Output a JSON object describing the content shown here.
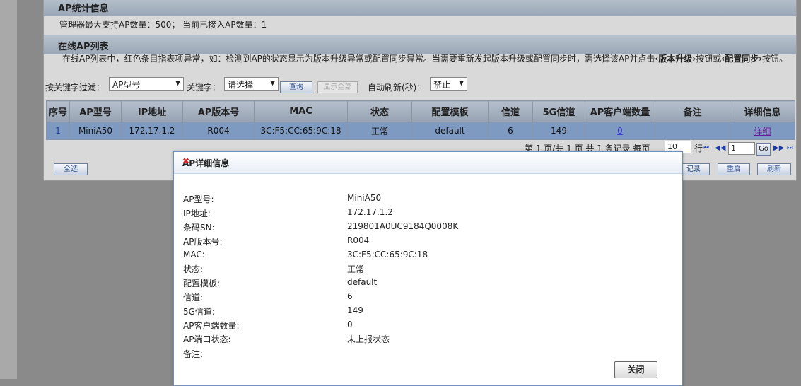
{
  "section1": {
    "title": "AP统计信息"
  },
  "stats": {
    "text": "管理器最大支持AP数量：500；  当前已接入AP数量：1"
  },
  "section2": {
    "title": "在线AP列表"
  },
  "description": {
    "part1": "在线AP列表中，红色条目指表项异常，如：检测到AP的状态显示为版本升级异常或配置同步异常。当需要重新发起版本升级或配置同步时，需选择该AP并点击",
    "btn1": "‹版本升级›",
    "mid": "按钮或",
    "btn2": "‹配置同步›",
    "part2": "按钮。"
  },
  "filter": {
    "label": "按关键字过滤：",
    "field_value": "AP型号",
    "keyword_label": "关键字：",
    "keyword_value": "请选择",
    "query_button": "查询",
    "show_all_button": "显示全部",
    "refresh_label": "自动刷新(秒)：",
    "refresh_value": "禁止"
  },
  "table": {
    "headers": [
      "序号",
      "AP型号",
      "IP地址",
      "AP版本号",
      "MAC",
      "状态",
      "配置模板",
      "信道",
      "5G信道",
      "AP客户端数量",
      "备注",
      "详细信息"
    ],
    "row": {
      "index": "1",
      "model": "MiniA50",
      "ip": "172.17.1.2",
      "version": "R004",
      "mac": "3C:F5:CC:65:9C:18",
      "status": "正常",
      "template": "default",
      "channel": "6",
      "channel5g": "149",
      "clients": "0",
      "note": "",
      "detail": "详细"
    }
  },
  "pager": {
    "summary": "第 1 页/共 1 页 共 1 条记录 每页",
    "per_page": "10",
    "rows_label": "行",
    "page_input": "1",
    "go": "Go"
  },
  "bottom_buttons": {
    "select_all": "全选",
    "record": "记录",
    "restart": "重启",
    "refresh": "刷新"
  },
  "modal": {
    "title": "AP详细信息",
    "fields": [
      {
        "label": "AP型号:",
        "value": "MiniA50"
      },
      {
        "label": "IP地址:",
        "value": "172.17.1.2"
      },
      {
        "label": "条码SN:",
        "value": "219801A0UC9184Q0008K"
      },
      {
        "label": "AP版本号:",
        "value": "R004"
      },
      {
        "label": "MAC:",
        "value": "3C:F5:CC:65:9C:18"
      },
      {
        "label": "状态:",
        "value": "正常"
      },
      {
        "label": "配置模板:",
        "value": "default"
      },
      {
        "label": "信道:",
        "value": "6"
      },
      {
        "label": "5G信道:",
        "value": "149"
      },
      {
        "label": "AP客户端数量:",
        "value": "0"
      },
      {
        "label": "AP端口状态:",
        "value": "未上报状态"
      },
      {
        "label": "备注:",
        "value": ""
      }
    ],
    "close_button": "关闭"
  },
  "icons": {
    "close": "close-icon",
    "dropdown": "chevron-down-icon",
    "pager_first": "first-page-icon",
    "pager_prev": "prev-page-icon",
    "pager_next": "next-page-icon",
    "pager_last": "last-page-icon"
  },
  "colors": {
    "selected_row": "#7e9ac0",
    "header": "#a3aebc",
    "close_x": "#d32020"
  }
}
